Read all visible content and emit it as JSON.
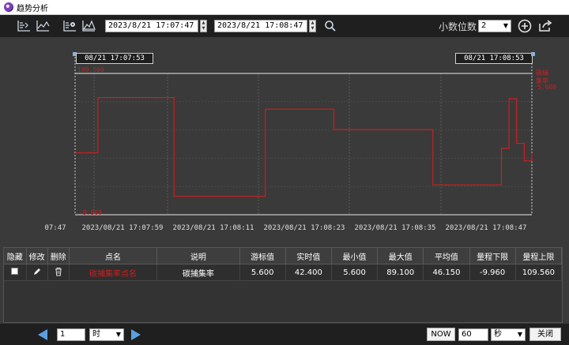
{
  "window": {
    "title": "趋势分析"
  },
  "toolbar": {
    "start_datetime": "2023/8/21 17:07:47",
    "end_datetime": "2023/8/21 17:08:47",
    "decimal_label": "小数位数",
    "decimal_value": "2",
    "icons": [
      "chart-tool-icon",
      "line-chart-icon",
      "settings-chart-icon",
      "mountain-chart-icon",
      "search-icon",
      "add-icon",
      "export-icon"
    ]
  },
  "chart": {
    "cursor_start": "08/21 17:07:53",
    "cursor_end": "08/21 17:08:53",
    "x_tick_labels": [
      "07:47",
      "2023/08/21 17:07:59",
      "2023/08/21 17:08:11",
      "2023/08/21 17:08:23",
      "2023/08/21 17:08:35",
      "2023/08/21 17:08:47"
    ],
    "y_top_label": "109.560",
    "y_bottom_label": "-9.960",
    "legend_name": "碳捕集率",
    "legend_value": "5.600",
    "line_color": "#cc1f1f"
  },
  "chart_data": {
    "type": "line",
    "ylim": [
      -9.96,
      109.56
    ],
    "series": [
      {
        "name": "碳捕集率",
        "x": [
          "17:07:47",
          "17:07:49",
          "17:07:50",
          "17:07:59",
          "17:07:60",
          "17:08:11",
          "17:08:12",
          "17:08:20",
          "17:08:21",
          "17:08:33",
          "17:08:34",
          "17:08:42",
          "17:08:43",
          "17:08:44",
          "17:08:45",
          "17:08:46",
          "17:08:47"
        ],
        "values": [
          42.4,
          42.4,
          89.1,
          89.1,
          5.6,
          5.6,
          79.4,
          79.4,
          62.1,
          62.1,
          15.3,
          15.3,
          46.2,
          88.2,
          50.4,
          35.6,
          42.4
        ]
      }
    ]
  },
  "table": {
    "headers": [
      "隐藏",
      "修改",
      "删除",
      "点名",
      "说明",
      "游标值",
      "实时值",
      "最小值",
      "最大值",
      "平均值",
      "量程下限",
      "量程上限"
    ],
    "rows": [
      {
        "name": "碳捕集率点名",
        "desc": "碳捕集率",
        "cursor": "5.600",
        "realtime": "42.400",
        "min": "5.600",
        "max": "89.100",
        "avg": "46.150",
        "range_low": "-9.960",
        "range_high": "109.560"
      }
    ]
  },
  "bottom": {
    "step_value": "1",
    "step_unit": "时",
    "now_label": "NOW",
    "interval_value": "60",
    "interval_unit": "秒",
    "close_label": "关闭"
  }
}
